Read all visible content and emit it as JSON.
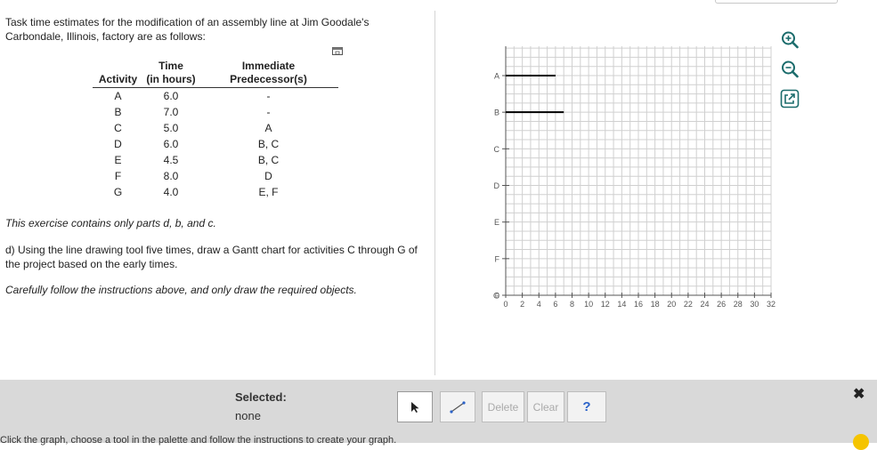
{
  "problem": {
    "intro": "Task time estimates for the modification of an assembly line at Jim Goodale's Carbondale, Illinois, factory are as follows:",
    "note": "This exercise contains only parts d, b, and c.",
    "part_d": "d) Using the line drawing tool five times, draw a Gantt chart for activities C through G of the project based on the early times.",
    "instruction": "Carefully follow the instructions above, and only draw the required objects."
  },
  "table": {
    "headers": {
      "activity": "Activity",
      "time_line1": "Time",
      "time_line2": "(in hours)",
      "pred_line1": "Immediate",
      "pred_line2": "Predecessor(s)"
    },
    "rows": [
      {
        "activity": "A",
        "time": "6.0",
        "pred": "-"
      },
      {
        "activity": "B",
        "time": "7.0",
        "pred": "-"
      },
      {
        "activity": "C",
        "time": "5.0",
        "pred": "A"
      },
      {
        "activity": "D",
        "time": "6.0",
        "pred": "B, C"
      },
      {
        "activity": "E",
        "time": "4.5",
        "pred": "B, C"
      },
      {
        "activity": "F",
        "time": "8.0",
        "pred": "D"
      },
      {
        "activity": "G",
        "time": "4.0",
        "pred": "E, F"
      }
    ]
  },
  "gantt": {
    "y_labels": [
      "A",
      "B",
      "C",
      "D",
      "E",
      "F",
      "G",
      "0"
    ],
    "x_ticks": [
      "0",
      "2",
      "4",
      "6",
      "8",
      "10",
      "12",
      "14",
      "16",
      "18",
      "20",
      "22",
      "24",
      "26",
      "28",
      "30",
      "32"
    ],
    "xlim": [
      0,
      32
    ],
    "bars": [
      {
        "activity": "A",
        "start": 0,
        "end": 6
      },
      {
        "activity": "B",
        "start": 0,
        "end": 7
      }
    ]
  },
  "side_icons": [
    "zoom-in-icon",
    "zoom-out-icon",
    "open-external-icon"
  ],
  "toolbar": {
    "selected_label": "Selected:",
    "selected_value": "none",
    "delete_label": "Delete",
    "clear_label": "Clear",
    "help_label": "?",
    "close_label": "✖"
  },
  "footer": {
    "text": "Click the graph, choose a tool in the palette and follow the instructions to create your graph."
  }
}
